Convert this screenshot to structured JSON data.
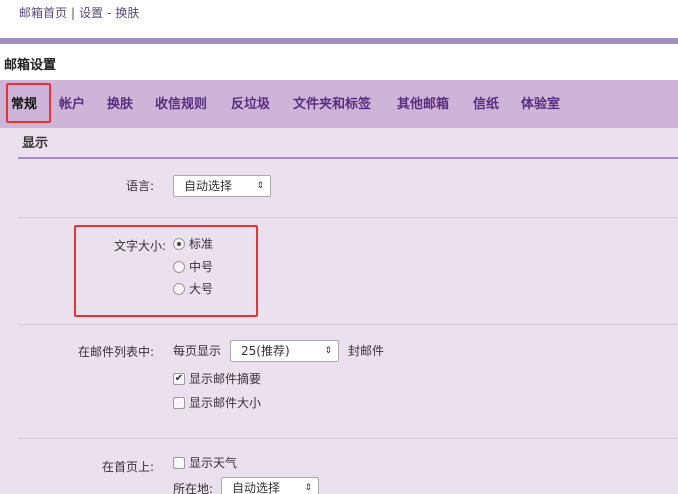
{
  "breadcrumb": {
    "home": "邮箱首页",
    "separator": "|",
    "settings": "设置",
    "dash": "-",
    "current": "换肤"
  },
  "settings_title": "邮箱设置",
  "tabs": [
    {
      "label": "常规",
      "active": true
    },
    {
      "label": "帐户"
    },
    {
      "label": "换肤"
    },
    {
      "label": "收信规则"
    },
    {
      "label": "反垃圾"
    },
    {
      "label": "文件夹和标签"
    },
    {
      "label": "其他邮箱"
    },
    {
      "label": "信纸"
    },
    {
      "label": "体验室"
    }
  ],
  "section": {
    "title": "显示"
  },
  "language": {
    "label": "语言:",
    "selected": "自动选择"
  },
  "font_size": {
    "label": "文字大小:",
    "options": [
      {
        "label": "标准",
        "checked": true
      },
      {
        "label": "中号",
        "checked": false
      },
      {
        "label": "大号",
        "checked": false
      }
    ]
  },
  "mail_list": {
    "label": "在邮件列表中:",
    "per_page_prefix": "每页显示",
    "per_page_selected": "25(推荐)",
    "per_page_suffix": "封邮件",
    "show_summary": {
      "label": "显示邮件摘要",
      "checked": true
    },
    "show_size": {
      "label": "显示邮件大小",
      "checked": false
    }
  },
  "home_page": {
    "label": "在首页上:",
    "show_weather": {
      "label": "显示天气",
      "checked": false
    },
    "location_label": "所在地:",
    "location_selected": "自动选择"
  },
  "colors": {
    "accent": "#a98bc5",
    "tabbar": "#cdb4d8",
    "content_bg": "#ebe0ee",
    "annotation": "#e63434"
  }
}
